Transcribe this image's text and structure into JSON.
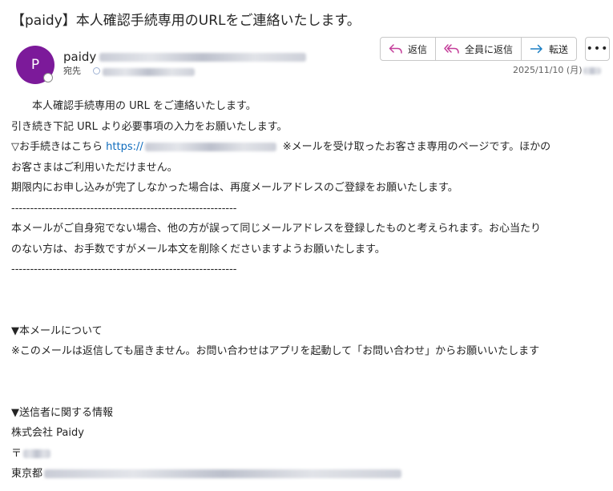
{
  "email": {
    "subject": "【paidy】本人確認手続専用のURLをご連絡いたします。",
    "sender_initial": "P",
    "sender_name": "paidy",
    "to_label": "宛先",
    "date": "2025/11/10 (月)"
  },
  "toolbar": {
    "reply_label": "返信",
    "reply_all_label": "全員に返信",
    "forward_label": "転送",
    "more_label": "•••"
  },
  "body": {
    "line1": "本人確認手続専用の URL をご連絡いたします。",
    "line2": "引き続き下記 URL より必要事項の入力をお願いたします。",
    "line3_prefix": "▽お手続きはこちら ",
    "line3_link": "https://",
    "line3_suffix": "※メールを受け取ったお客さま専用のページです。ほかの",
    "line4": "お客さまはご利用いただけません。",
    "line5": "期限内にお申し込みが完了しなかった場合は、再度メールアドレスのご登録をお願いたします。",
    "divider1": "------------------------------------------------------------",
    "line6": "本メールがご自身宛でない場合、他の方が誤って同じメールアドレスを登録したものと考えられます。お心当たり",
    "line7": "のない方は、お手数ですがメール本文を削除くださいますようお願いたします。",
    "divider2": "------------------------------------------------------------",
    "about_heading": "▼本メールについて",
    "about_text": "※このメールは返信しても届きません。お問い合わせはアプリを起動して「お問い合わせ」からお願いいたします",
    "sender_heading": "▼送信者に関する情報",
    "company": "株式会社 Paidy",
    "postal_prefix": "〒",
    "address_prefix": "東京都"
  }
}
